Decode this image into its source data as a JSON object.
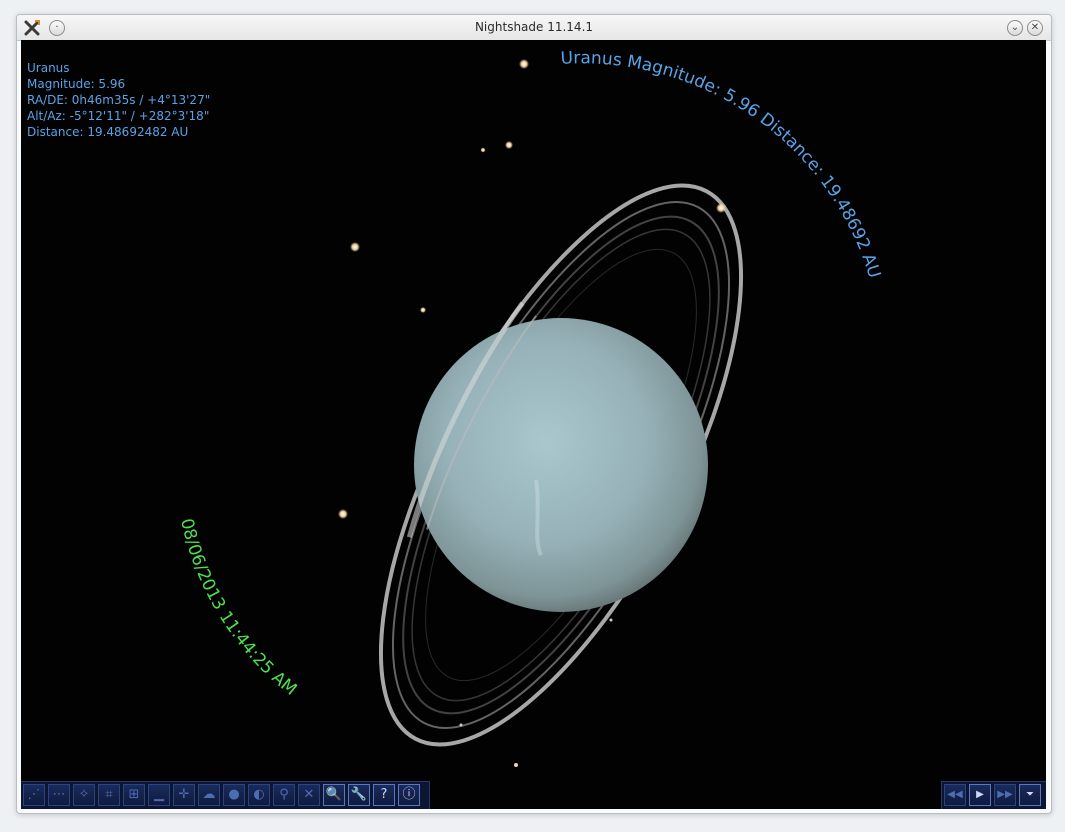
{
  "window": {
    "title": "Nightshade 11.14.1",
    "icons": [
      "nightshade-x-icon",
      "menu-icon",
      "minimize-icon",
      "close-icon"
    ]
  },
  "object_info": {
    "name": "Uranus",
    "magnitude": "Magnitude: 5.96",
    "radec": "RA/DE: 0h46m35s / +4°13'27\"",
    "altaz": "Alt/Az: -5°12'11\" / +282°3'18\"",
    "distance": "Distance: 19.48692482 AU"
  },
  "object_arc_label": "Uranus  Magnitude: 5.96  Distance: 19.48692 AU",
  "date_arc_label": "08/06/2013 11:44:25 AM",
  "colors": {
    "info_text": "#5aa3e6",
    "date_text": "#4fe04f",
    "sky": "#020203",
    "planet": "#9db9bf",
    "toolbar": "#0c1633"
  },
  "toolbar": {
    "buttons": [
      {
        "name": "constellation-lines-icon",
        "glyph": "⋰"
      },
      {
        "name": "constellation-labels-icon",
        "glyph": "⋯"
      },
      {
        "name": "constellation-art-icon",
        "glyph": "✧"
      },
      {
        "name": "azimuthal-grid-icon",
        "glyph": "⌗"
      },
      {
        "name": "equatorial-grid-icon",
        "glyph": "⊞"
      },
      {
        "name": "ground-icon",
        "glyph": "▁"
      },
      {
        "name": "cardinal-points-icon",
        "glyph": "✛"
      },
      {
        "name": "atmosphere-icon",
        "glyph": "☁"
      },
      {
        "name": "nebulae-icon",
        "glyph": "●"
      },
      {
        "name": "planet-labels-icon",
        "glyph": "◐"
      },
      {
        "name": "telescope-icon",
        "glyph": "⚲"
      },
      {
        "name": "night-mode-icon",
        "glyph": "✕"
      },
      {
        "name": "search-icon",
        "glyph": "🔍"
      },
      {
        "name": "configuration-icon",
        "glyph": "🔧"
      },
      {
        "name": "help-icon",
        "glyph": "?"
      },
      {
        "name": "info-icon",
        "glyph": "ⓘ"
      }
    ]
  },
  "time_controls": {
    "buttons": [
      {
        "name": "rewind-icon",
        "glyph": "◀◀"
      },
      {
        "name": "play-icon",
        "glyph": "▶"
      },
      {
        "name": "fast-forward-icon",
        "glyph": "▶▶"
      },
      {
        "name": "time-menu-icon",
        "glyph": "⏷"
      }
    ]
  }
}
